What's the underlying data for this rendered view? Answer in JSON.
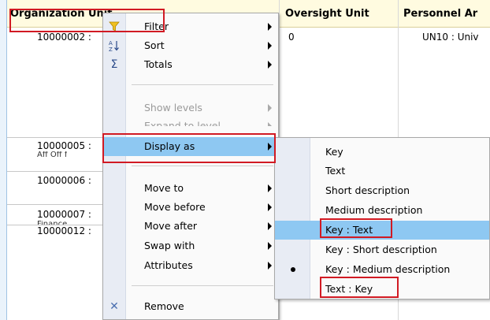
{
  "grid": {
    "columns": [
      {
        "label": "Organization Unit"
      },
      {
        "label": "Oversight Unit"
      },
      {
        "label": "Personnel Ar"
      }
    ],
    "rows": [
      {
        "id": "10000002 :",
        "oversight": "0",
        "personnel": "UN10 : Univ"
      },
      {
        "id": "10000005 :",
        "sub": "Aff Off f"
      },
      {
        "id": "10000006 :"
      },
      {
        "id": "10000007 :",
        "sub": "Finance"
      },
      {
        "id": "10000012 :"
      }
    ]
  },
  "menu": {
    "filter": "Filter",
    "sort": "Sort",
    "totals": "Totals",
    "show_levels": "Show levels",
    "expand_to_level": "Expand to level",
    "display_as": "Display as",
    "move_to": "Move to",
    "move_before": "Move before",
    "move_after": "Move after",
    "swap_with": "Swap with",
    "attributes": "Attributes",
    "remove": "Remove"
  },
  "submenu": {
    "items": [
      {
        "label": "Key"
      },
      {
        "label": "Text"
      },
      {
        "label": "Short description"
      },
      {
        "label": "Medium description"
      },
      {
        "label": "Key : Text"
      },
      {
        "label": "Key : Short description"
      },
      {
        "label": "Key : Medium description"
      },
      {
        "label": "Text : Key"
      }
    ],
    "selected_index": 6,
    "highlighted_index": 4
  },
  "colors": {
    "highlight": "#8ec8f2",
    "annotation_red": "#d11a23",
    "header_bg": "#fffbe0"
  },
  "icons": {
    "filter": "funnel-icon",
    "sort": "sort-az-icon",
    "totals": "sigma-icon",
    "remove": "x-icon"
  }
}
